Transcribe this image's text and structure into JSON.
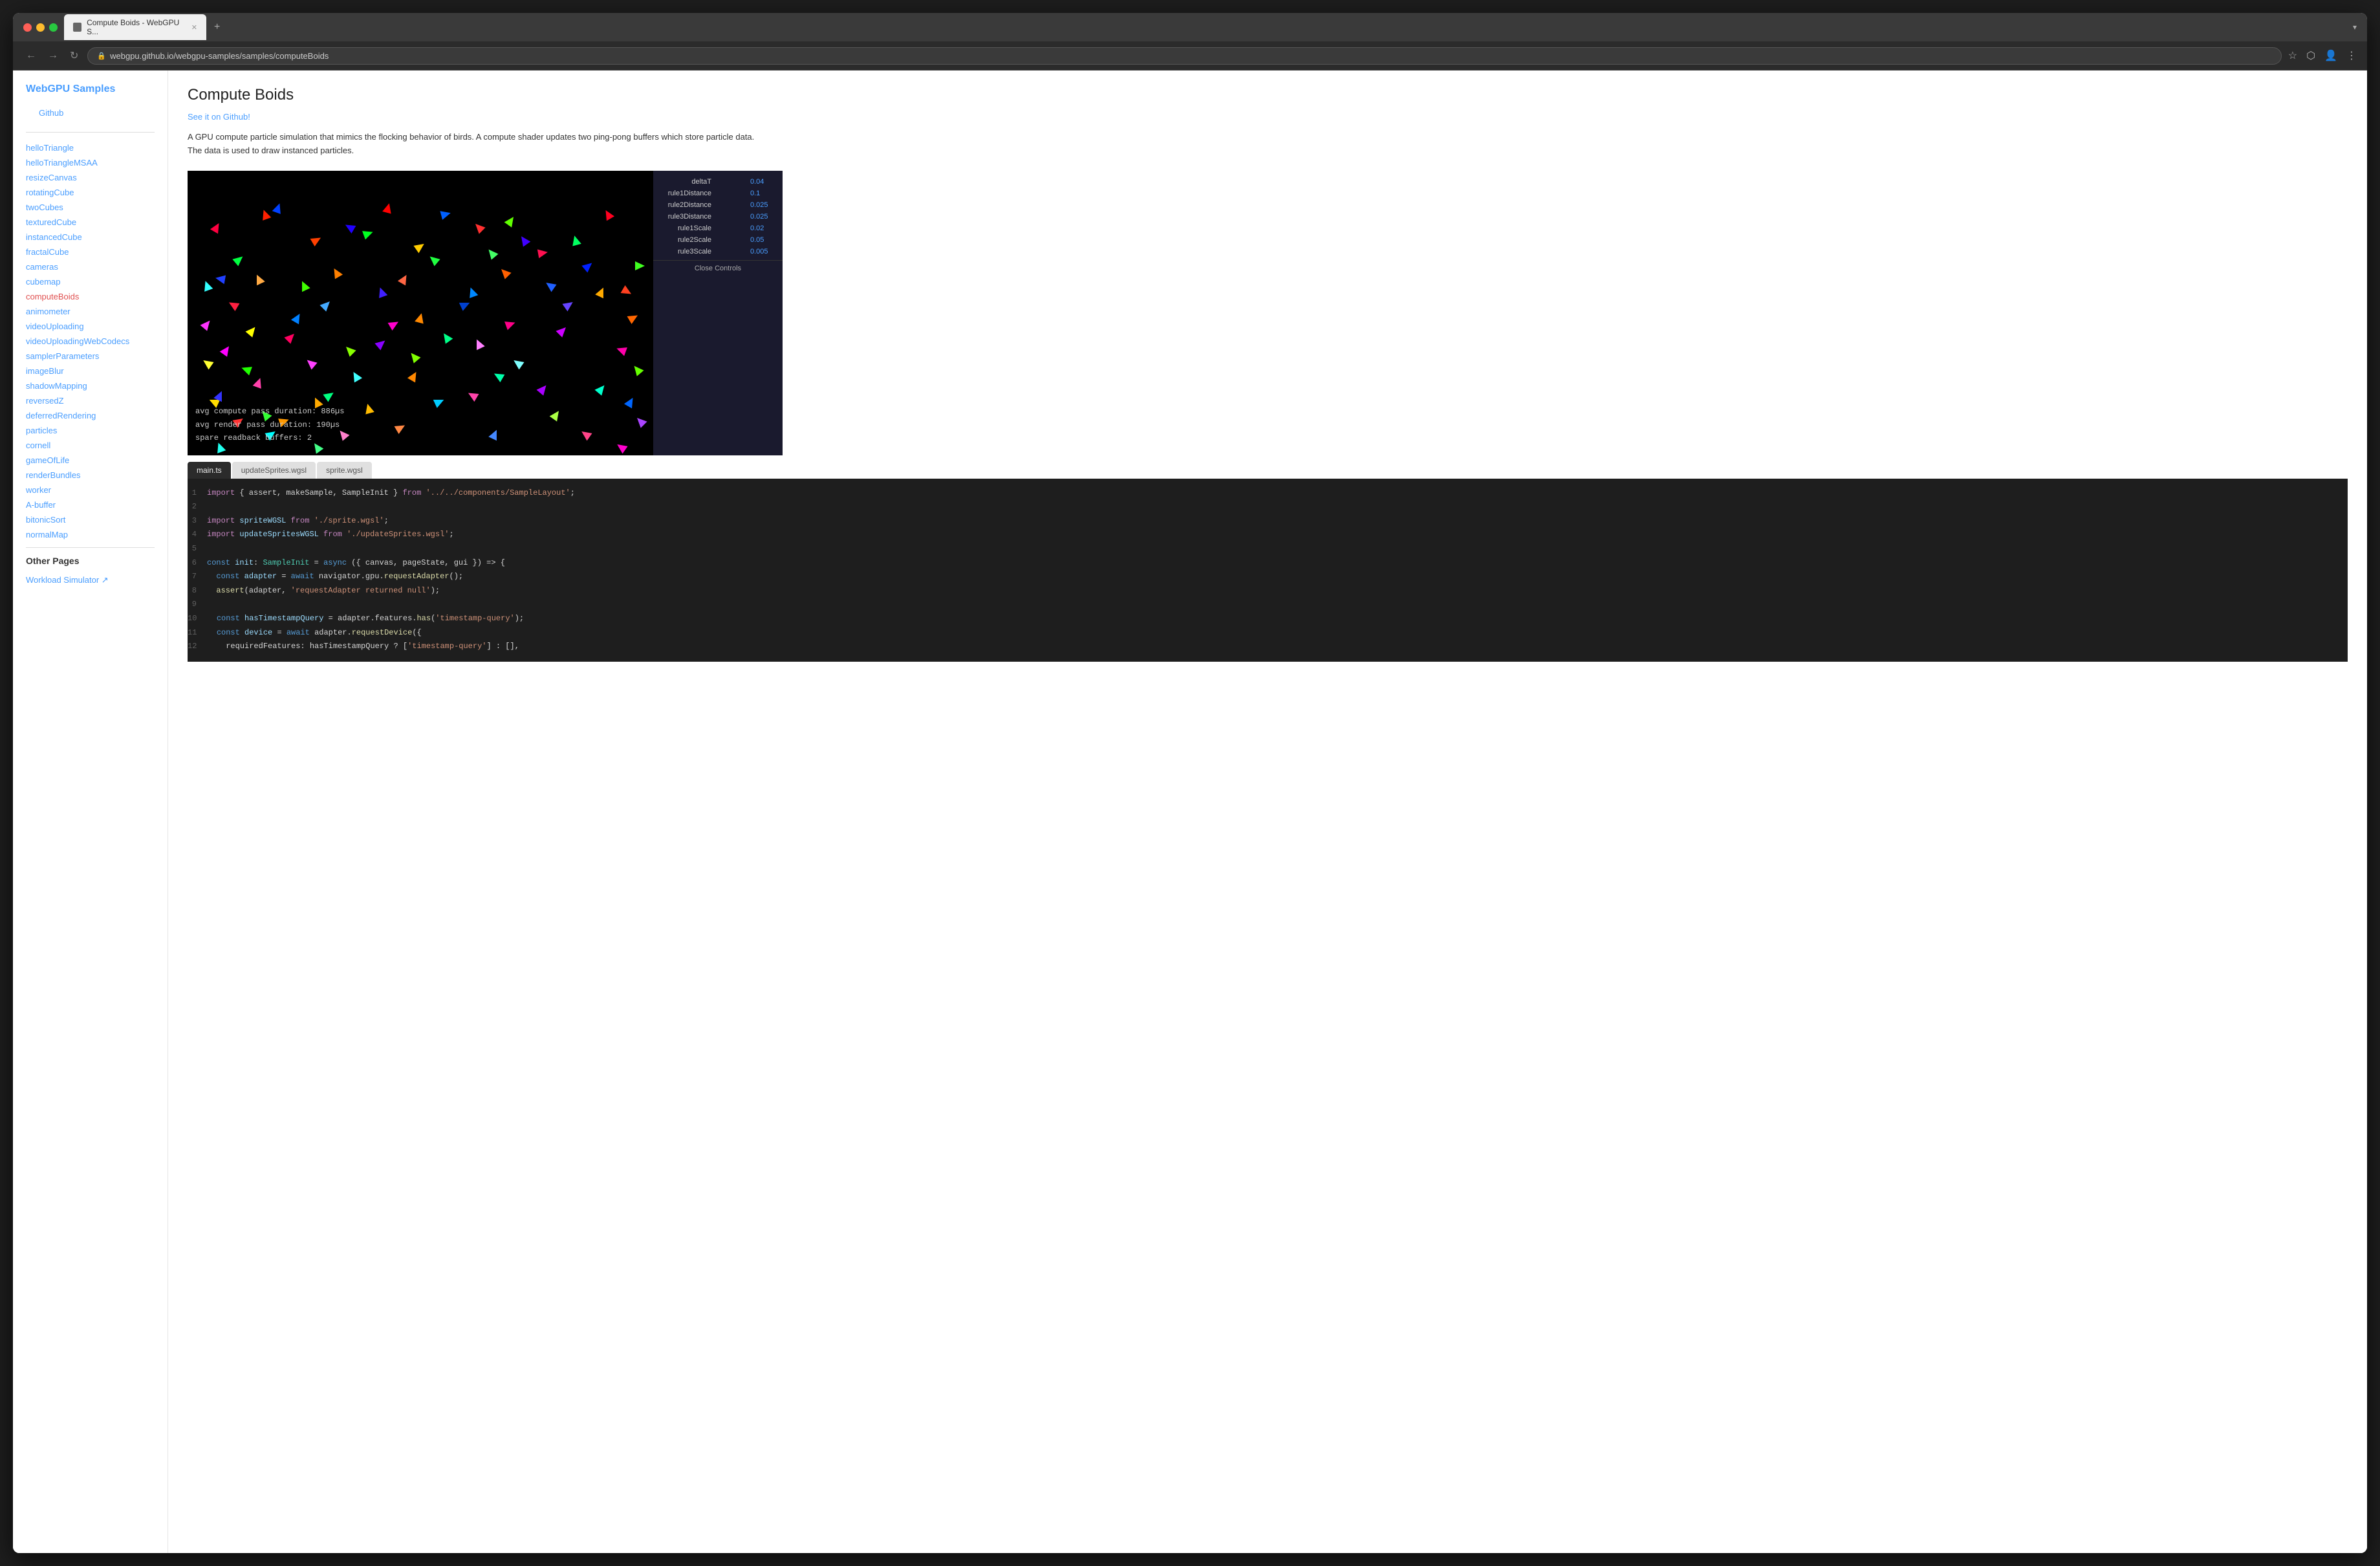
{
  "browser": {
    "tab_label": "Compute Boids - WebGPU S...",
    "new_tab_label": "+",
    "url": "webgpu.github.io/webgpu-samples/samples/computeBoids",
    "dropdown_icon": "▾"
  },
  "sidebar": {
    "title": "WebGPU Samples",
    "github_link": "Github",
    "items": [
      {
        "label": "helloTriangle",
        "active": false
      },
      {
        "label": "helloTriangleMSAA",
        "active": false
      },
      {
        "label": "resizeCanvas",
        "active": false
      },
      {
        "label": "rotatingCube",
        "active": false
      },
      {
        "label": "twoCubes",
        "active": false
      },
      {
        "label": "texturedCube",
        "active": false
      },
      {
        "label": "instancedCube",
        "active": false
      },
      {
        "label": "fractalCube",
        "active": false
      },
      {
        "label": "cameras",
        "active": false
      },
      {
        "label": "cubemap",
        "active": false
      },
      {
        "label": "computeBoids",
        "active": true
      },
      {
        "label": "animometer",
        "active": false
      },
      {
        "label": "videoUploading",
        "active": false
      },
      {
        "label": "videoUploadingWebCodecs",
        "active": false
      },
      {
        "label": "samplerParameters",
        "active": false
      },
      {
        "label": "imageBlur",
        "active": false
      },
      {
        "label": "shadowMapping",
        "active": false
      },
      {
        "label": "reversedZ",
        "active": false
      },
      {
        "label": "deferredRendering",
        "active": false
      },
      {
        "label": "particles",
        "active": false
      },
      {
        "label": "cornell",
        "active": false
      },
      {
        "label": "gameOfLife",
        "active": false
      },
      {
        "label": "renderBundles",
        "active": false
      },
      {
        "label": "worker",
        "active": false
      },
      {
        "label": "A-buffer",
        "active": false
      },
      {
        "label": "bitonicSort",
        "active": false
      },
      {
        "label": "normalMap",
        "active": false
      }
    ],
    "other_pages_title": "Other Pages",
    "other_links": [
      {
        "label": "Workload Simulator ↗"
      }
    ]
  },
  "main": {
    "title": "Compute Boids",
    "github_link": "See it on Github!",
    "description": "A GPU compute particle simulation that mimics the flocking behavior of birds. A compute shader updates two ping-pong buffers which store particle data. The data is used to draw instanced particles.",
    "stats": {
      "compute_pass": "avg compute pass duration:  886µs",
      "render_pass": "avg render pass duration:   190µs",
      "spare_readback": "spare readback buffers:      2"
    },
    "controls": {
      "deltaT_label": "deltaT",
      "deltaT_value": "0.04",
      "rule1Distance_label": "rule1Distance",
      "rule1Distance_value": "0.1",
      "rule2Distance_label": "rule2Distance",
      "rule2Distance_value": "0.025",
      "rule3Distance_label": "rule3Distance",
      "rule3Distance_value": "0.025",
      "rule1Scale_label": "rule1Scale",
      "rule1Scale_value": "0.02",
      "rule2Scale_label": "rule2Scale",
      "rule2Scale_value": "0.05",
      "rule3Scale_label": "rule3Scale",
      "rule3Scale_value": "0.005",
      "close_btn": "Close Controls"
    },
    "code_tabs": [
      {
        "label": "main.ts",
        "active": true
      },
      {
        "label": "updateSprites.wgsl",
        "active": false
      },
      {
        "label": "sprite.wgsl",
        "active": false
      }
    ],
    "code_lines": [
      {
        "num": "1",
        "content": "import { assert, makeSample, SampleInit } from '../../components/SampleLayout';"
      },
      {
        "num": "2",
        "content": ""
      },
      {
        "num": "3",
        "content": "import spriteWGSL from './sprite.wgsl';"
      },
      {
        "num": "4",
        "content": "import updateSpritesWGSL from './updateSprites.wgsl';"
      },
      {
        "num": "5",
        "content": ""
      },
      {
        "num": "6",
        "content": "const init: SampleInit = async ({ canvas, pageState, gui }) => {"
      },
      {
        "num": "7",
        "content": "  const adapter = await navigator.gpu.requestAdapter();"
      },
      {
        "num": "8",
        "content": "  assert(adapter, 'requestAdapter returned null');"
      },
      {
        "num": "9",
        "content": ""
      },
      {
        "num": "10",
        "content": "  const hasTimestampQuery = adapter.features.has('timestamp-query');"
      },
      {
        "num": "11",
        "content": "  const device = await adapter.requestDevice({"
      },
      {
        "num": "12",
        "content": "    requiredFeatures: hasTimestampQuery ? ['timestamp-query'] : [],"
      }
    ]
  }
}
